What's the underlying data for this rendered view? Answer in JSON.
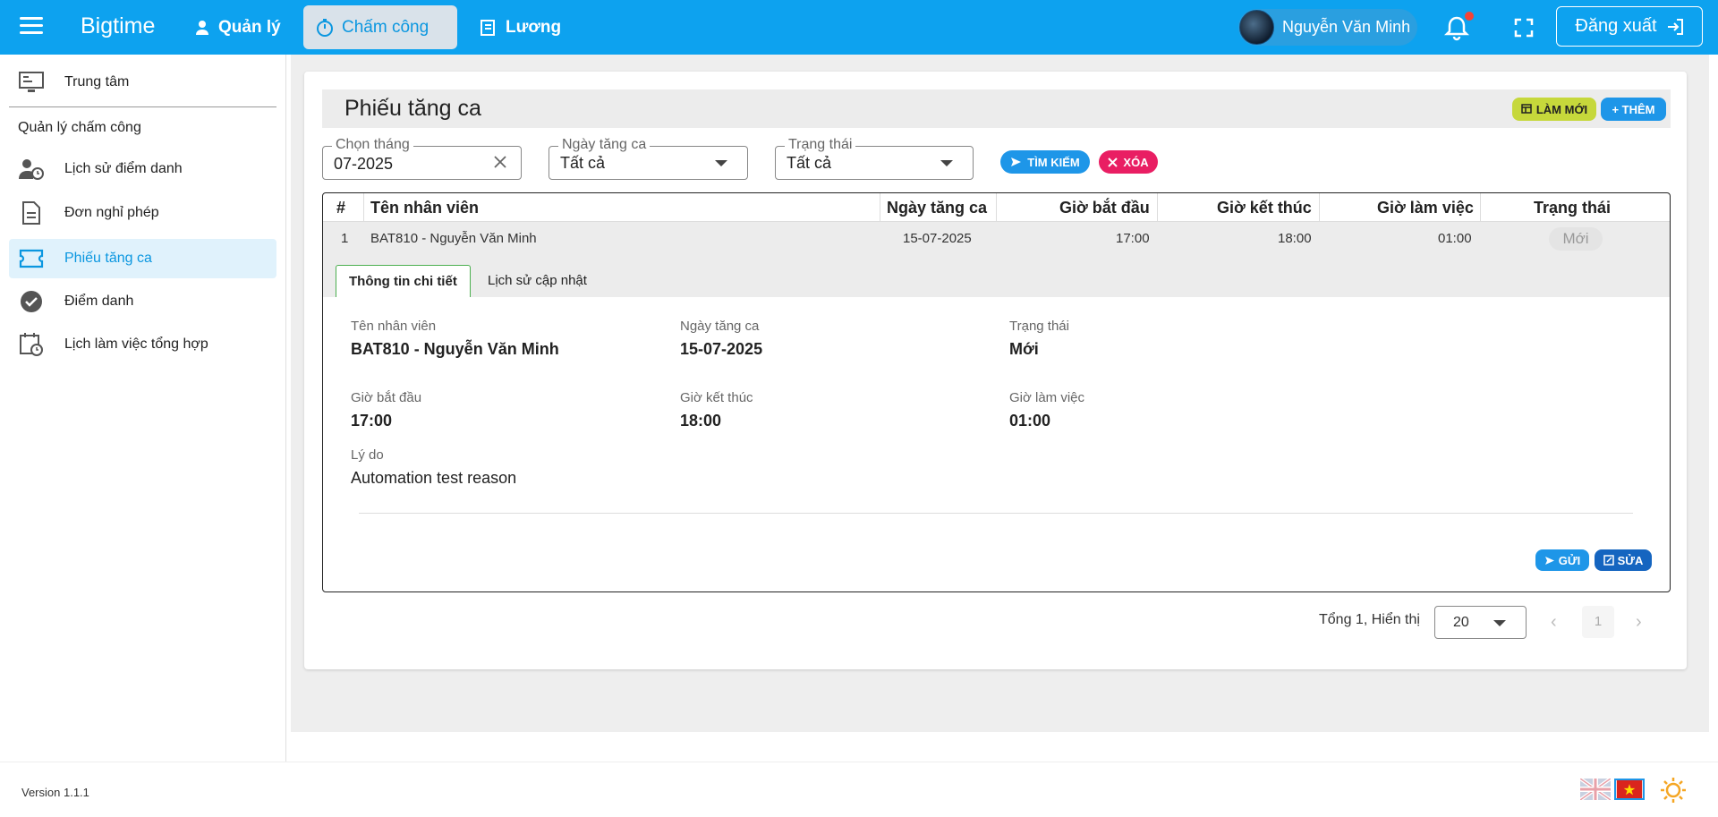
{
  "app": {
    "brand": "Bigtime"
  },
  "topnav": [
    {
      "label": "Quản lý",
      "icon": "user-tie-icon"
    },
    {
      "label": "Chấm công",
      "icon": "stopwatch-icon",
      "active": true
    },
    {
      "label": "Lương",
      "icon": "payslip-icon"
    }
  ],
  "user": {
    "name": "Nguyễn Văn Minh"
  },
  "header": {
    "logout_label": "Đăng xuất"
  },
  "sidebar": {
    "top_item": "Trung tâm",
    "section_title": "Quản lý chấm công",
    "items": [
      {
        "label": "Lịch sử điểm danh",
        "icon": "user-clock-icon"
      },
      {
        "label": "Đơn nghỉ phép",
        "icon": "document-icon"
      },
      {
        "label": "Phiếu tăng ca",
        "icon": "ticket-icon",
        "active": true
      },
      {
        "label": "Điểm danh",
        "icon": "check-circle-icon"
      },
      {
        "label": "Lịch làm việc tổng hợp",
        "icon": "calendar-clock-icon"
      }
    ]
  },
  "page": {
    "title": "Phiếu tăng ca",
    "refresh_label": "LÀM MỚI",
    "add_label": "+ THÊM"
  },
  "filters": {
    "month_label": "Chọn tháng",
    "month_value": "07-2025",
    "ot_date_label": "Ngày tăng ca",
    "ot_date_value": "Tất cả",
    "status_label": "Trạng thái",
    "status_value": "Tất cả",
    "search_label": "TÌM KIẾM",
    "clear_label": "XÓA"
  },
  "table": {
    "headers": [
      "#",
      "Tên nhân viên",
      "Ngày tăng ca",
      "Giờ bắt đầu",
      "Giờ kết thúc",
      "Giờ làm việc",
      "Trạng thái"
    ],
    "rows": [
      {
        "index": "1",
        "employee": "BAT810 - Nguyễn Văn Minh",
        "date": "15-07-2025",
        "start": "17:00",
        "end": "18:00",
        "hours": "01:00",
        "status": "Mới"
      }
    ]
  },
  "detail": {
    "tabs": [
      "Thông tin chi tiết",
      "Lịch sử cập nhật"
    ],
    "employee_label": "Tên nhân viên",
    "employee_value": "BAT810 - Nguyễn Văn Minh",
    "date_label": "Ngày tăng ca",
    "date_value": "15-07-2025",
    "status_label": "Trạng thái",
    "status_value": "Mới",
    "start_label": "Giờ bắt đầu",
    "start_value": "17:00",
    "end_label": "Giờ kết thúc",
    "end_value": "18:00",
    "hours_label": "Giờ làm việc",
    "hours_value": "01:00",
    "reason_label": "Lý do",
    "reason_value": "Automation test reason",
    "send_label": "GỬI",
    "edit_label": "SỬA"
  },
  "pagination": {
    "total_text": "Tổng 1,  Hiển thị",
    "page_size": "20",
    "current_page": "1"
  },
  "footer": {
    "version": "Version 1.1.1"
  },
  "colors": {
    "primary": "#0da2ef",
    "accent_green": "#c6d83b",
    "danger": "#e91e63"
  }
}
